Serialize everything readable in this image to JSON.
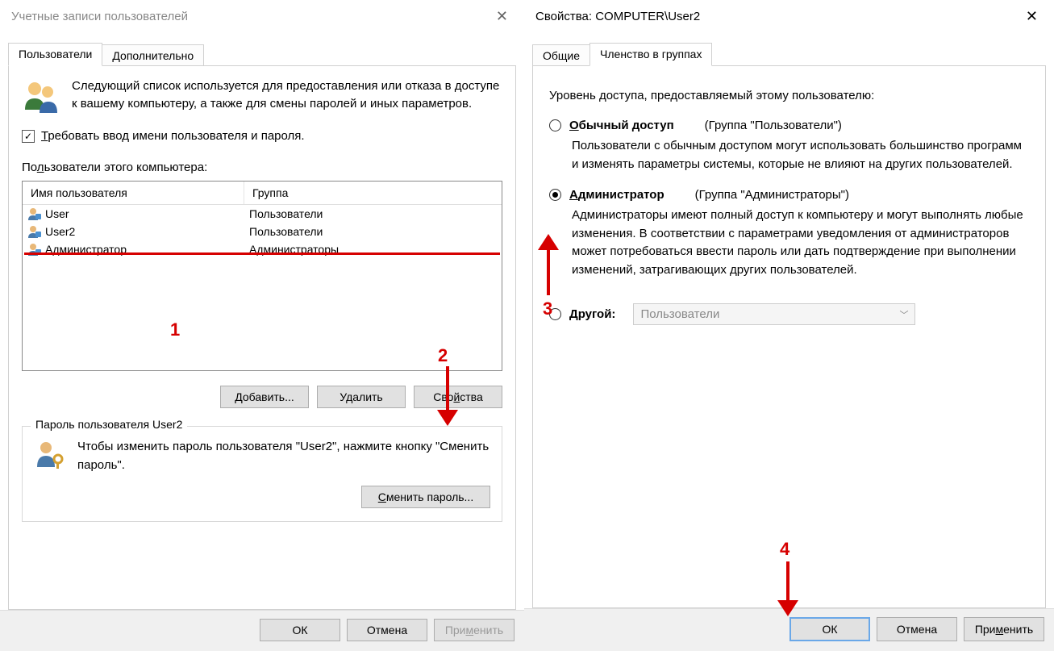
{
  "left": {
    "title": "Учетные записи пользователей",
    "tabs": {
      "users": "Пользователи",
      "advanced": "Дополнительно"
    },
    "intro": "Следующий список используется для предоставления или отказа в доступе к вашему компьютеру, а также для смены паролей и иных параметров.",
    "require_login": "Требовать ввод имени пользователя и пароля.",
    "users_of_computer": "Пользователи этого компьютера:",
    "columns": {
      "name": "Имя пользователя",
      "group": "Группа"
    },
    "rows": [
      {
        "name": "User",
        "group": "Пользователи"
      },
      {
        "name": "User2",
        "group": "Пользователи"
      },
      {
        "name": "Администратор",
        "group": "Администраторы"
      }
    ],
    "buttons": {
      "add": "Добавить...",
      "remove": "Удалить",
      "props": "Свойства"
    },
    "pw_group_title": "Пароль пользователя User2",
    "pw_text": "Чтобы изменить пароль пользователя \"User2\", нажмите кнопку \"Сменить пароль\".",
    "change_pw": "Сменить пароль...",
    "footer": {
      "ok": "ОК",
      "cancel": "Отмена",
      "apply": "Применить"
    }
  },
  "right": {
    "title": "Свойства: COMPUTER\\User2",
    "tabs": {
      "general": "Общие",
      "membership": "Членство в группах"
    },
    "access_label": "Уровень доступа, предоставляемый этому пользователю:",
    "radio_standard": {
      "title": "Обычный доступ",
      "note": "(Группа \"Пользователи\")",
      "desc": "Пользователи с обычным доступом могут использовать большинство программ и изменять параметры системы, которые не влияют на других пользователей."
    },
    "radio_admin": {
      "title": "Администратор",
      "note": "(Группа \"Администраторы\")",
      "desc": "Администраторы имеют полный доступ к компьютеру и могут выполнять любые изменения. В соответствии с параметрами уведомления от администраторов может потребоваться ввести пароль или дать подтверждение при выполнении изменений, затрагивающих других пользователей."
    },
    "radio_other": {
      "title": "Другой:",
      "dropdown": "Пользователи"
    },
    "footer": {
      "ok": "ОК",
      "cancel": "Отмена",
      "apply": "Применить"
    }
  },
  "annotations": {
    "n1": "1",
    "n2": "2",
    "n3": "3",
    "n4": "4"
  }
}
